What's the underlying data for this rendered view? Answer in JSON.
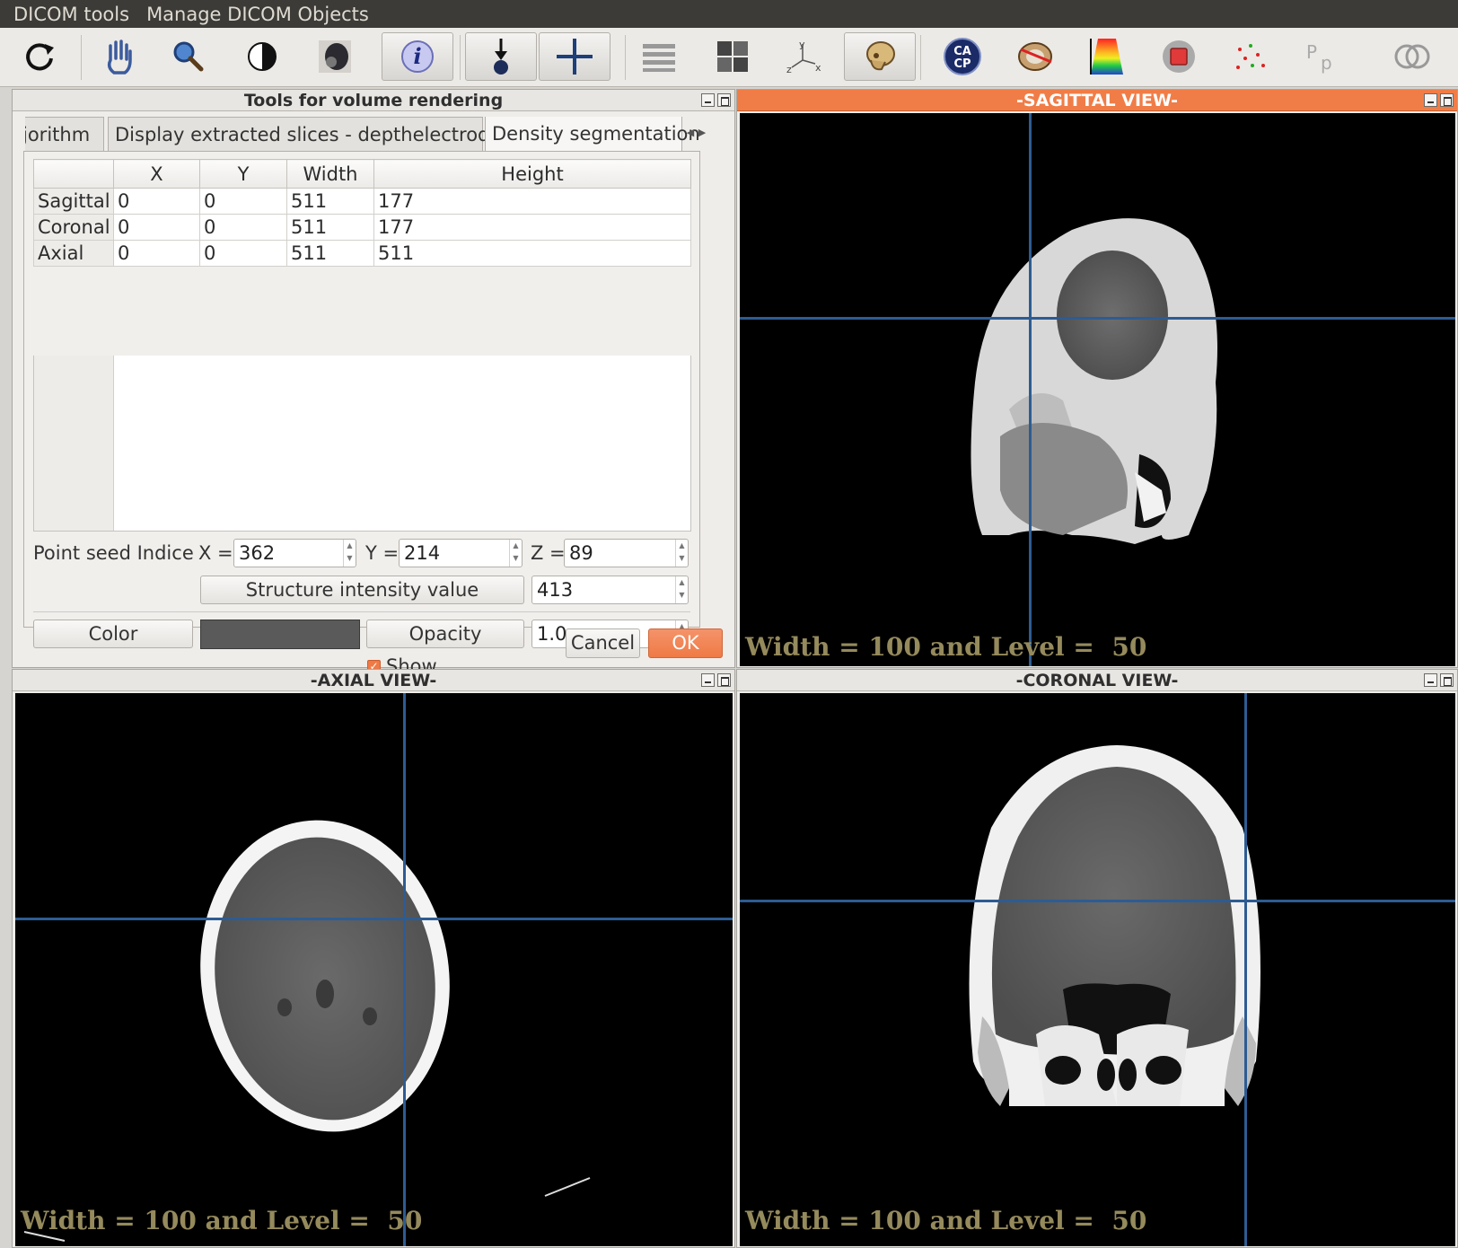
{
  "menu": {
    "dicom_tools": "DICOM tools",
    "manage_dicom": "Manage DICOM Objects"
  },
  "toolbar": {
    "icons": [
      "refresh-icon",
      "hand-pan-icon",
      "zoom-icon",
      "contrast-icon",
      "head-render-icon",
      "info-icon",
      "seed-point-icon",
      "crosshair-icon",
      "layers-icon",
      "grid-layout-icon",
      "axes-icon",
      "skull-icon",
      "ca-cp-icon",
      "brain-electrode-icon",
      "color-map-icon",
      "stop-icon",
      "point-cloud-icon",
      "pp-icon",
      "overlay-rings-icon"
    ],
    "ca_label_top": "CA",
    "ca_label_bottom": "CP",
    "info_glyph": "i"
  },
  "tools_panel": {
    "title": "Tools for volume rendering",
    "tabs": [
      "jorithm",
      "Display extracted slices - depthelectrodes",
      "Density segmentation"
    ],
    "selected_tab": "Density segmentation",
    "table": {
      "headers": [
        "",
        "X",
        "Y",
        "Width",
        "Height"
      ],
      "rows": [
        [
          "Sagittal",
          "0",
          "0",
          "511",
          "177"
        ],
        [
          "Coronal",
          "0",
          "0",
          "511",
          "177"
        ],
        [
          "Axial",
          "0",
          "0",
          "511",
          "511"
        ]
      ]
    },
    "seed": {
      "label": "Point seed Indice",
      "x_label": "X =",
      "x": "362",
      "y_label": "Y =",
      "y": "214",
      "z_label": "Z =",
      "z": "89"
    },
    "intensity_button": "Structure intensity value",
    "intensity_value": "413",
    "color_button": "Color",
    "color_value": "#5a5a5a",
    "opacity_button": "Opacity",
    "opacity_value": "1.0",
    "show_label": "Show",
    "show_checked": true,
    "cancel_label": "Cancel",
    "ok_label": "OK"
  },
  "views": {
    "sagittal": {
      "title": "-SAGITTAL VIEW-",
      "wl": "Width = 100 and Level =  50",
      "active": true
    },
    "axial": {
      "title": "-AXIAL VIEW-",
      "wl": "Width = 100 and Level =  50"
    },
    "coronal": {
      "title": "-CORONAL VIEW-",
      "wl": "Width = 100 and Level =  50"
    }
  },
  "colors": {
    "accent": "#f07d47",
    "crosshair": "#2d5c93",
    "overlay_text": "#958a5c"
  }
}
